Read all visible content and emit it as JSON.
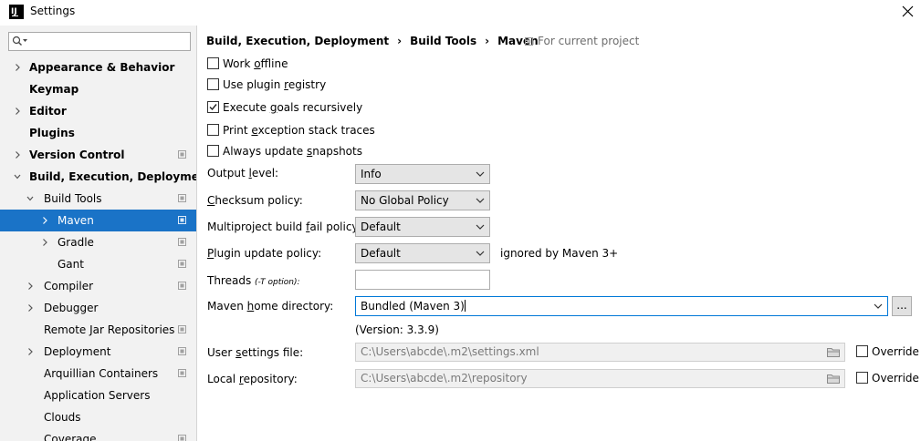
{
  "window": {
    "title": "Settings"
  },
  "search": {
    "placeholder": ""
  },
  "sidebar": {
    "items": [
      {
        "label": "Appearance & Behavior",
        "bold": true,
        "level": 0,
        "arrow": "right",
        "project": false
      },
      {
        "label": "Keymap",
        "bold": true,
        "level": 0,
        "arrow": "none",
        "project": false
      },
      {
        "label": "Editor",
        "bold": true,
        "level": 0,
        "arrow": "right",
        "project": false
      },
      {
        "label": "Plugins",
        "bold": true,
        "level": 0,
        "arrow": "none",
        "project": false
      },
      {
        "label": "Version Control",
        "bold": true,
        "level": 0,
        "arrow": "right",
        "project": true
      },
      {
        "label": "Build, Execution, Deployment",
        "bold": true,
        "level": 0,
        "arrow": "down",
        "project": false
      },
      {
        "label": "Build Tools",
        "bold": false,
        "level": 1,
        "arrow": "down",
        "project": true
      },
      {
        "label": "Maven",
        "bold": false,
        "level": 2,
        "arrow": "right",
        "project": true,
        "selected": true
      },
      {
        "label": "Gradle",
        "bold": false,
        "level": 2,
        "arrow": "right",
        "project": true
      },
      {
        "label": "Gant",
        "bold": false,
        "level": 2,
        "arrow": "none",
        "project": true
      },
      {
        "label": "Compiler",
        "bold": false,
        "level": 1,
        "arrow": "right",
        "project": true
      },
      {
        "label": "Debugger",
        "bold": false,
        "level": 1,
        "arrow": "right",
        "project": false
      },
      {
        "label": "Remote Jar Repositories",
        "bold": false,
        "level": 1,
        "arrow": "none",
        "project": true
      },
      {
        "label": "Deployment",
        "bold": false,
        "level": 1,
        "arrow": "right",
        "project": true
      },
      {
        "label": "Arquillian Containers",
        "bold": false,
        "level": 1,
        "arrow": "none",
        "project": true
      },
      {
        "label": "Application Servers",
        "bold": false,
        "level": 1,
        "arrow": "none",
        "project": false
      },
      {
        "label": "Clouds",
        "bold": false,
        "level": 1,
        "arrow": "none",
        "project": false
      },
      {
        "label": "Coverage",
        "bold": false,
        "level": 1,
        "arrow": "none",
        "project": true
      }
    ]
  },
  "breadcrumb": {
    "parts": [
      "Build, Execution, Deployment",
      "Build Tools",
      "Maven"
    ],
    "separator": "›",
    "scope": "For current project"
  },
  "options": {
    "work_offline": {
      "pre": "Work ",
      "u": "o",
      "post": "ffline",
      "checked": false
    },
    "use_plugin_registry": {
      "pre": "Use plugin ",
      "u": "r",
      "post": "egistry",
      "checked": false
    },
    "execute_goals_recursively": {
      "pre": "Execute ",
      "u": "g",
      "post": "oals recursively",
      "checked": true
    },
    "print_exception_stack_traces": {
      "pre": "Print ",
      "u": "e",
      "post": "xception stack traces",
      "checked": false
    },
    "always_update_snapshots": {
      "pre": "Always update ",
      "u": "s",
      "post": "napshots",
      "checked": false
    }
  },
  "fields": {
    "output_level": {
      "pre": "Output ",
      "u": "l",
      "post": "evel:",
      "value": "Info"
    },
    "checksum_policy": {
      "pre": "",
      "u": "C",
      "post": "hecksum policy:",
      "value": "No Global Policy"
    },
    "multiproject_fail_policy": {
      "pre": "Multiproject build ",
      "u": "f",
      "post": "ail policy:",
      "value": "Default"
    },
    "plugin_update_policy": {
      "pre": "",
      "u": "P",
      "post": "lugin update policy:",
      "value": "Default",
      "hint": "ignored by Maven 3+"
    },
    "threads": {
      "label": "Threads ",
      "option": "(-T option):",
      "value": ""
    },
    "maven_home": {
      "pre": "Maven ",
      "u": "h",
      "post": "ome directory:",
      "value": "Bundled (Maven 3)",
      "version": "(Version: 3.3.9)",
      "browse": "..."
    },
    "user_settings": {
      "pre": "User ",
      "u": "s",
      "post": "ettings file:",
      "value": "C:\\Users\\abcde\\.m2\\settings.xml",
      "override": "Override",
      "override_checked": false
    },
    "local_repository": {
      "pre": "Local ",
      "u": "r",
      "post": "epository:",
      "value": "C:\\Users\\abcde\\.m2\\repository",
      "override": "Override",
      "override_checked": false
    }
  },
  "colors": {
    "selected": "#1a73c7",
    "sidebar_bg": "#f2f2f2",
    "focus_border": "#0078d7"
  }
}
